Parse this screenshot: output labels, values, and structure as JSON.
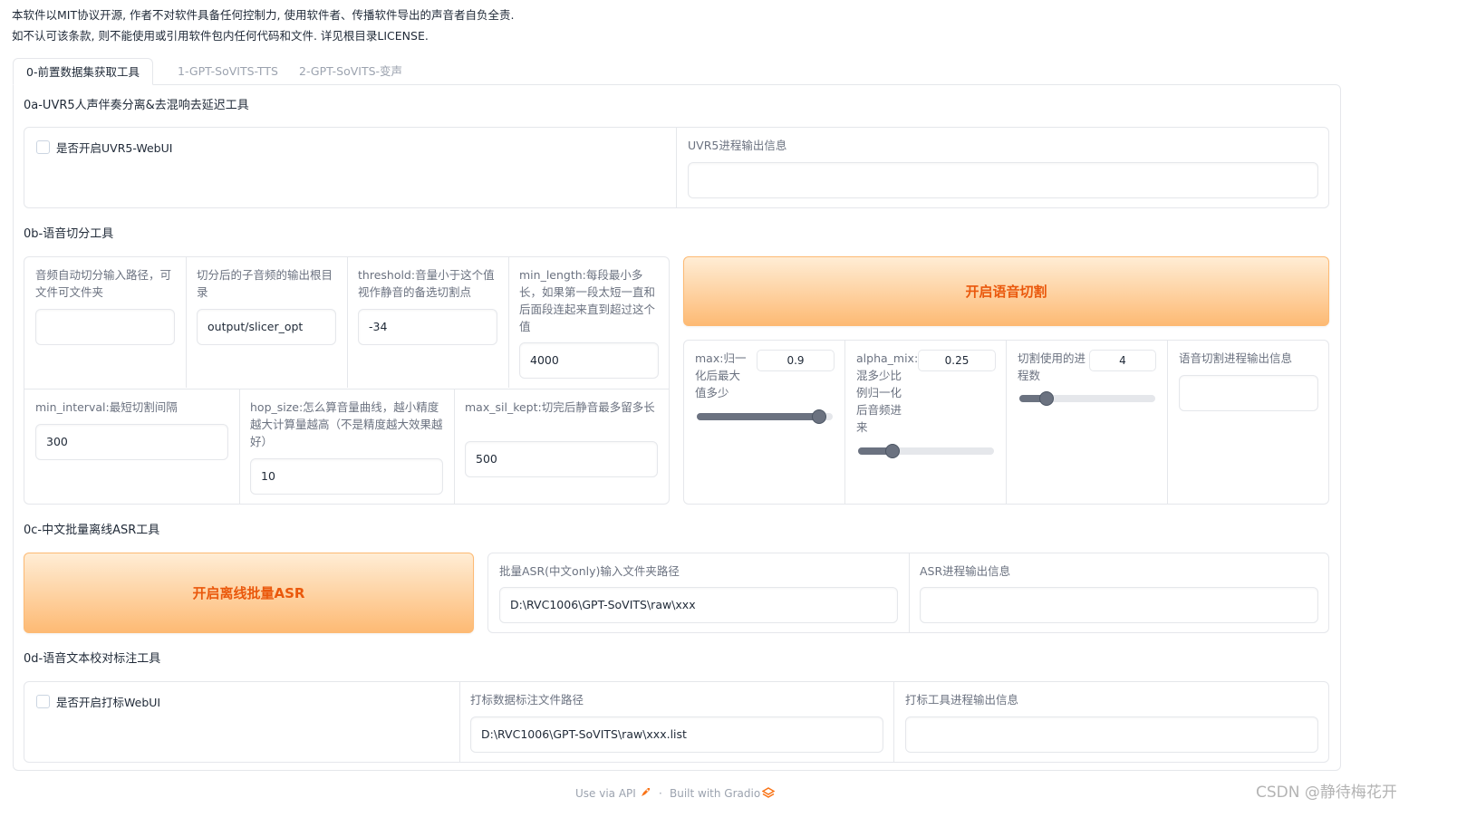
{
  "notice": {
    "line1": "本软件以MIT协议开源, 作者不对软件具备任何控制力, 使用软件者、传播软件导出的声音者自负全责.",
    "line2": "如不认可该条款, 则不能使用或引用软件包内任何代码和文件. 详见根目录LICENSE."
  },
  "tabs": [
    "0-前置数据集获取工具",
    "1-GPT-SoVITS-TTS",
    "2-GPT-SoVITS-变声"
  ],
  "uvr5": {
    "section_title": "0a-UVR5人声伴奏分离&去混响去延迟工具",
    "checkbox_label": "是否开启UVR5-WebUI",
    "output_label": "UVR5进程输出信息",
    "output_value": ""
  },
  "slicer": {
    "section_title": "0b-语音切分工具",
    "input_path_label": "音频自动切分输入路径，可文件可文件夹",
    "input_path_value": "",
    "output_root_label": "切分后的子音频的输出根目录",
    "output_root_value": "output/slicer_opt",
    "threshold_label": "threshold:音量小于这个值视作静音的备选切割点",
    "threshold_value": "-34",
    "min_length_label": "min_length:每段最小多长，如果第一段太短一直和后面段连起来直到超过这个值",
    "min_length_value": "4000",
    "min_interval_label": "min_interval:最短切割间隔",
    "min_interval_value": "300",
    "hop_size_label": "hop_size:怎么算音量曲线，越小精度越大计算量越高（不是精度越大效果越好）",
    "hop_size_value": "10",
    "max_sil_kept_label": "max_sil_kept:切完后静音最多留多长",
    "max_sil_kept_value": "500",
    "start_button": "开启语音切割",
    "max_label": "max:归一化后最大值多少",
    "max_value": "0.9",
    "max_fraction": 0.9,
    "alpha_label": "alpha_mix:混多少比例归一化后音频进来",
    "alpha_value": "0.25",
    "alpha_fraction": 0.25,
    "procs_label": "切割使用的进程数",
    "procs_value": "4",
    "procs_fraction": 0.2,
    "output_label": "语音切割进程输出信息",
    "output_value": ""
  },
  "asr": {
    "section_title": "0c-中文批量离线ASR工具",
    "start_button": "开启离线批量ASR",
    "input_label": "批量ASR(中文only)输入文件夹路径",
    "input_value": "D:\\RVC1006\\GPT-SoVITS\\raw\\xxx",
    "output_label": "ASR进程输出信息",
    "output_value": ""
  },
  "label_tool": {
    "section_title": "0d-语音文本校对标注工具",
    "checkbox_label": "是否开启打标WebUI",
    "path_label": "打标数据标注文件路径",
    "path_value": "D:\\RVC1006\\GPT-SoVITS\\raw\\xxx.list",
    "output_label": "打标工具进程输出信息",
    "output_value": ""
  },
  "footer": {
    "api": "Use via API",
    "separator": "·",
    "built": "Built with Gradio"
  },
  "watermark": "CSDN @静待梅花开",
  "colors": {
    "accent_text": "#ea580c",
    "button_gradient_start": "#ffedd5",
    "button_gradient_end": "#fdba74",
    "border": "#e5e7eb"
  }
}
